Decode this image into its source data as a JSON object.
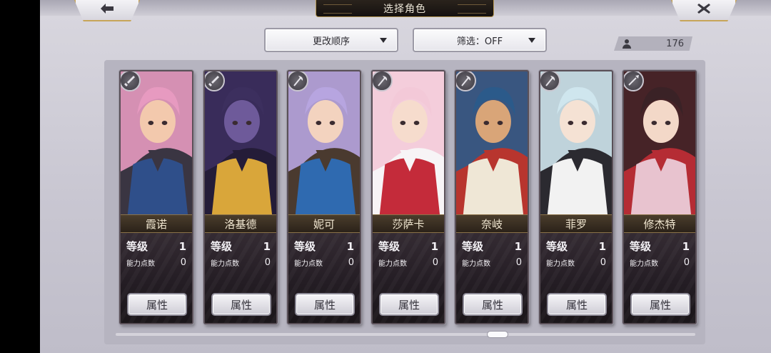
{
  "header": {
    "title": "选择角色"
  },
  "controls": {
    "order_label": "更改顺序",
    "filter_label": "筛选：OFF",
    "character_count": "176"
  },
  "labels": {
    "level": "等级",
    "ability_points": "能力点数",
    "attribute_button": "属性"
  },
  "characters": [
    {
      "name": "霞诺",
      "level": "1",
      "points": "0",
      "weapon": "sword-icon",
      "palette": [
        "#e79ac0",
        "#3a3542",
        "#f3c9ad",
        "#2f4f8a"
      ]
    },
    {
      "name": "洛基德",
      "level": "1",
      "points": "0",
      "weapon": "sword-icon",
      "palette": [
        "#3c2f5e",
        "#241c38",
        "#6e5a9a",
        "#d9a63a"
      ]
    },
    {
      "name": "妮可",
      "level": "1",
      "points": "0",
      "weapon": "axe-icon",
      "palette": [
        "#b7a5e0",
        "#4a3a2f",
        "#f3d3bf",
        "#2f6ab0"
      ]
    },
    {
      "name": "莎萨卡",
      "level": "1",
      "points": "0",
      "weapon": "axe-icon",
      "palette": [
        "#f3c9d8",
        "#f7f4f6",
        "#f6dccd",
        "#c42b3a"
      ]
    },
    {
      "name": "奈岐",
      "level": "1",
      "points": "0",
      "weapon": "axe-icon",
      "palette": [
        "#2b5a8a",
        "#b8352e",
        "#d9a578",
        "#efe7d6"
      ]
    },
    {
      "name": "菲罗",
      "level": "1",
      "points": "0",
      "weapon": "axe-icon",
      "palette": [
        "#cfe6ee",
        "#2b2a30",
        "#f5e2d4",
        "#f2f2f2"
      ]
    },
    {
      "name": "修杰特",
      "level": "1",
      "points": "0",
      "weapon": "spear-icon",
      "palette": [
        "#3a2226",
        "#b52c34",
        "#f3d8c8",
        "#e8c3cf"
      ]
    }
  ]
}
